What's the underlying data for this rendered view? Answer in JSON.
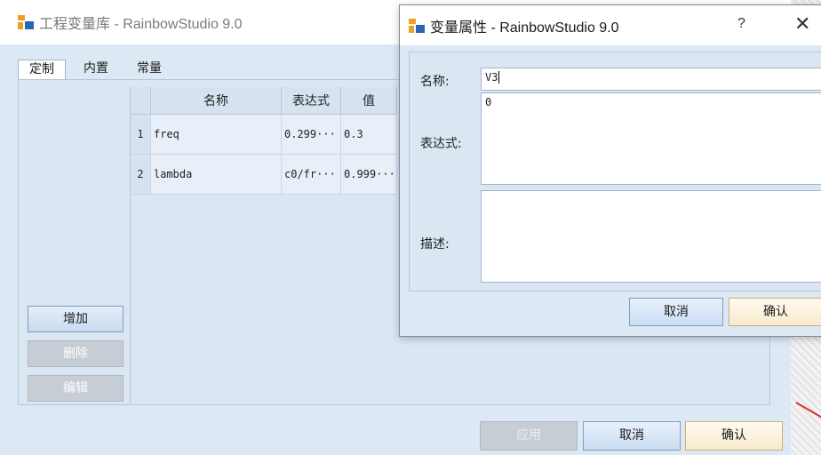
{
  "main_window": {
    "title": "工程变量库 - RainbowStudio 9.0",
    "tabs": [
      "定制",
      "内置",
      "常量"
    ],
    "columns": [
      "名称",
      "表达式",
      "值"
    ],
    "rows": [
      {
        "index": "1",
        "name": "freq",
        "expression": "0.299···",
        "value": "0.3"
      },
      {
        "index": "2",
        "name": "lambda",
        "expression": "c0/fr···",
        "value": "0.999···"
      }
    ],
    "side_buttons": {
      "add": "增加",
      "delete": "删除",
      "edit": "编辑"
    },
    "footer_buttons": {
      "apply": "应用",
      "cancel": "取消",
      "ok": "确认"
    }
  },
  "dialog": {
    "title": "变量属性 - RainbowStudio 9.0",
    "help": "?",
    "close": "✕",
    "labels": {
      "name": "名称:",
      "expression": "表达式:",
      "description": "描述:"
    },
    "values": {
      "name": "V3",
      "expression": "0",
      "description": ""
    },
    "buttons": {
      "cancel": "取消",
      "ok": "确认"
    }
  },
  "colors": {
    "accent": "#2a64b8",
    "icon_orange": "#f0a020",
    "window_bg": "#dde8f5"
  }
}
